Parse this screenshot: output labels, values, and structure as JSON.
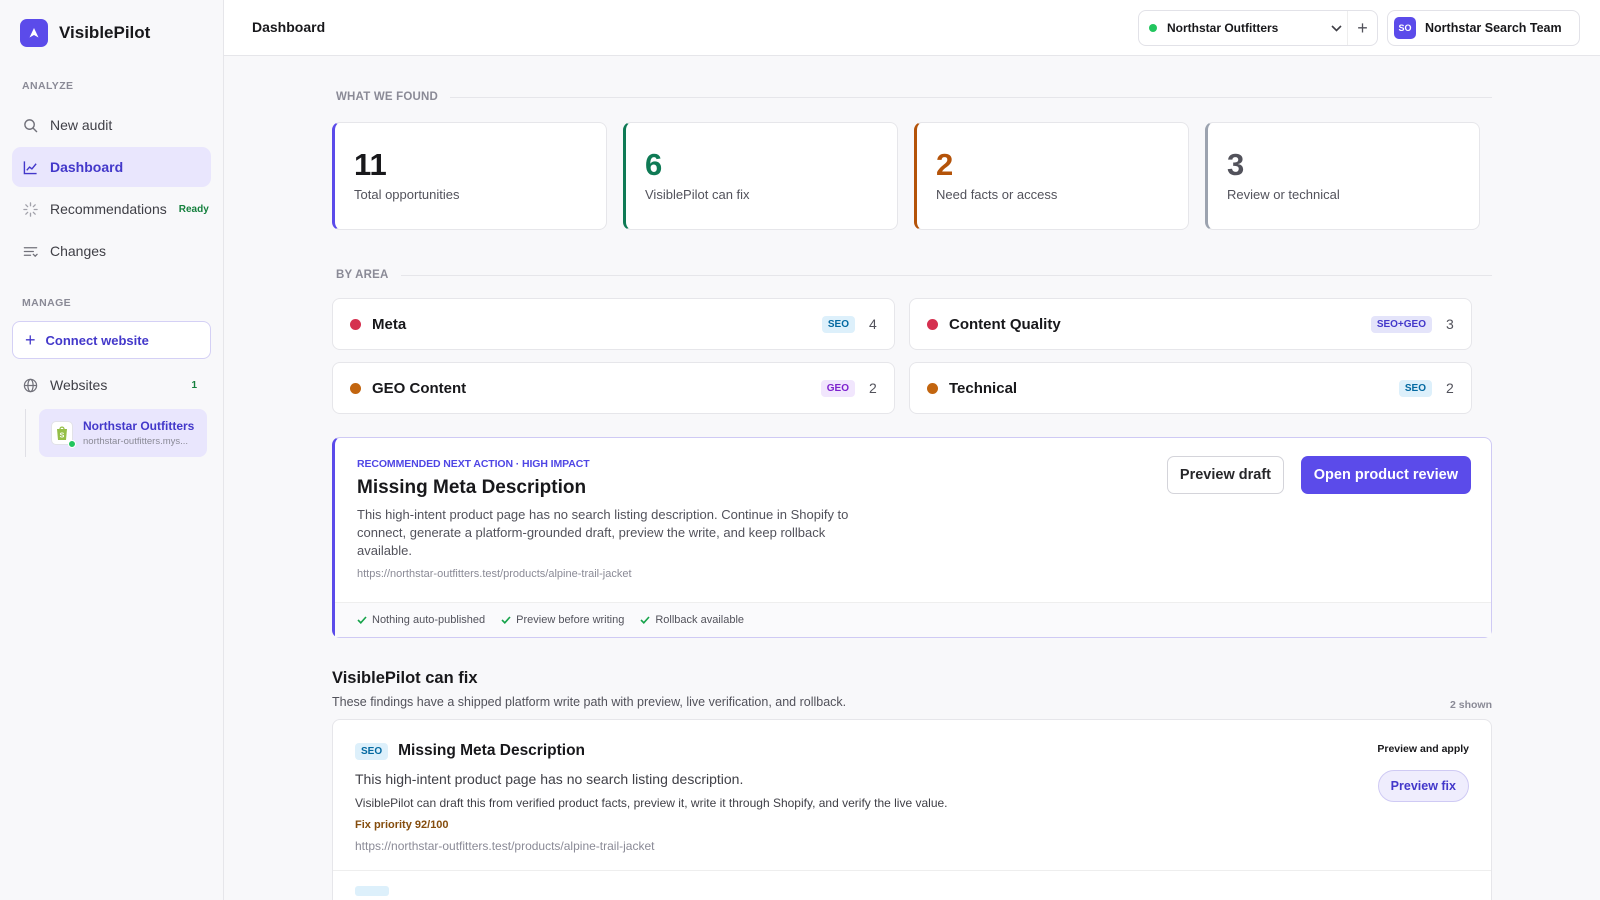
{
  "brand": {
    "name": "VisiblePilot"
  },
  "sidebar": {
    "analyze_label": "ANALYZE",
    "manage_label": "MANAGE",
    "items": [
      {
        "label": "New audit"
      },
      {
        "label": "Dashboard"
      },
      {
        "label": "Recommendations",
        "badge": "Ready"
      },
      {
        "label": "Changes"
      }
    ],
    "connect_label": "Connect website",
    "websites_label": "Websites",
    "websites_count": "1",
    "site": {
      "name": "Northstar Outfitters",
      "url": "northstar-outfitters.mys..."
    }
  },
  "topbar": {
    "title": "Dashboard",
    "store": "Northstar Outfitters",
    "team_initials": "SO",
    "team_name": "Northstar Search Team"
  },
  "found": {
    "label": "WHAT WE FOUND",
    "stats": [
      {
        "value": "11",
        "label": "Total opportunities",
        "color": "#5b4bea"
      },
      {
        "value": "6",
        "label": "VisiblePilot can fix",
        "color": "#0f7a55"
      },
      {
        "value": "2",
        "label": "Need facts or access",
        "color": "#b45309"
      },
      {
        "value": "3",
        "label": "Review or technical",
        "color": "#52525b"
      }
    ]
  },
  "areas": {
    "label": "BY AREA",
    "items": [
      {
        "name": "Meta",
        "tag": "SEO",
        "count": "4",
        "dot": "#d5304f"
      },
      {
        "name": "Content Quality",
        "tag": "SEO+GEO",
        "count": "3",
        "dot": "#d5304f"
      },
      {
        "name": "GEO Content",
        "tag": "GEO",
        "count": "2",
        "dot": "#c2650f"
      },
      {
        "name": "Technical",
        "tag": "SEO",
        "count": "2",
        "dot": "#c2650f"
      }
    ]
  },
  "next_action": {
    "eyebrow": "RECOMMENDED NEXT ACTION · HIGH IMPACT",
    "title": "Missing Meta Description",
    "description": "This high-intent product page has no search listing description. Continue in Shopify to connect, generate a platform-grounded draft, preview the write, and keep rollback available.",
    "url": "https://northstar-outfitters.test/products/alpine-trail-jacket",
    "preview_label": "Preview draft",
    "open_label": "Open product review",
    "checks": [
      "Nothing auto-published",
      "Preview before writing",
      "Rollback available"
    ]
  },
  "can_fix": {
    "title": "VisiblePilot can fix",
    "subtitle": "These findings have a shipped platform write path with preview, live verification, and rollback.",
    "shown": "2 shown",
    "items": [
      {
        "tag": "SEO",
        "title": "Missing Meta Description",
        "description": "This high-intent product page has no search listing description.",
        "detail": "VisiblePilot can draft this from verified product facts, preview it, write it through Shopify, and verify the live value.",
        "priority": "Fix priority 92/100",
        "url": "https://northstar-outfitters.test/products/alpine-trail-jacket",
        "mode": "Preview and apply",
        "button": "Preview fix"
      }
    ]
  }
}
